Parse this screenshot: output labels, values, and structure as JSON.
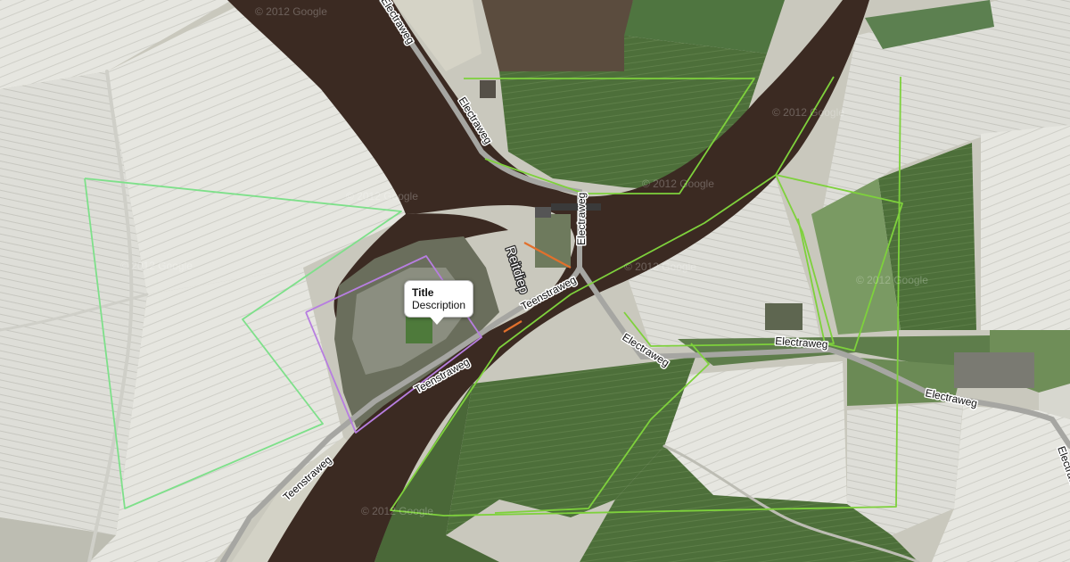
{
  "map": {
    "view": "satellite",
    "watermark_text": "© 2012 Google",
    "info_window": {
      "title": "Title",
      "description": "Description"
    },
    "labels": {
      "electraweg": "Electraweg",
      "teenstraweg": "Teenstraweg",
      "reitdiep": "Reitdiep"
    },
    "overlay_colors": {
      "green_bright": "#7ed13c",
      "green_light": "#7ee08a",
      "purple": "#b77ee0",
      "orange": "#e2702c"
    }
  }
}
